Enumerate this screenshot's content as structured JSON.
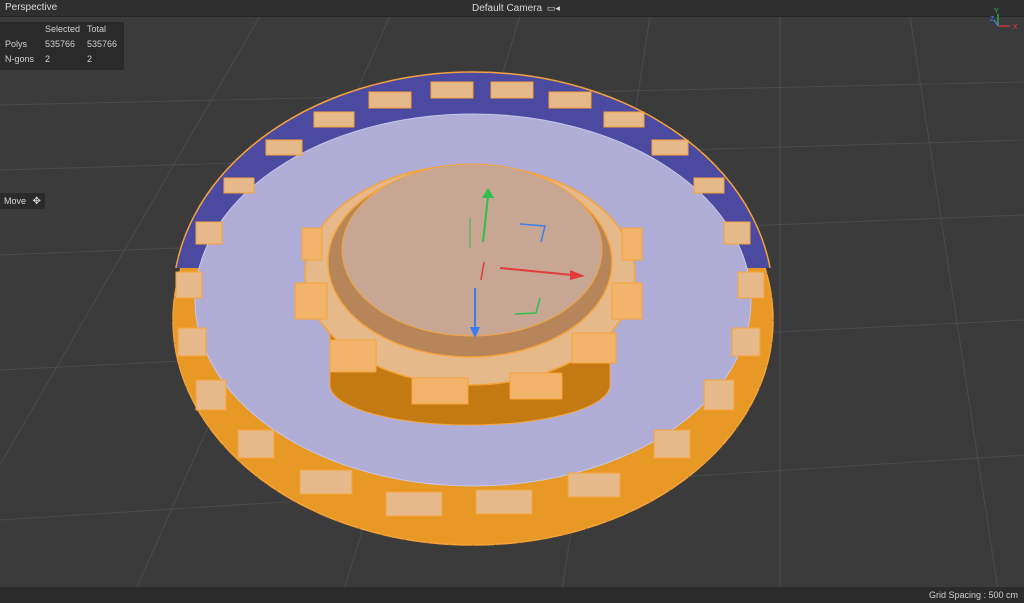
{
  "viewport": {
    "name": "Perspective",
    "camera": "Default Camera",
    "camera_icon": "camera-icon"
  },
  "stats": {
    "header": {
      "selected": "Selected",
      "total": "Total"
    },
    "rows": [
      {
        "label": "Polys",
        "selected": "535766",
        "total": "535766"
      },
      {
        "label": "N-gons",
        "selected": "2",
        "total": "2"
      }
    ]
  },
  "tool": {
    "label": "Move",
    "icon": "move-icon"
  },
  "axes": {
    "x": "X",
    "y": "Y",
    "z": "Z"
  },
  "footer": {
    "grid_spacing": "Grid Spacing : 500 cm"
  },
  "colors": {
    "background": "#3b3b3b",
    "selection_orange": "#f7a33a",
    "wall_blue": "#4b4aa0",
    "floor_lavender": "#b0aed6",
    "arena_top": "#c7a793",
    "axis_x": "#e33b3b",
    "axis_y": "#2fbf4a",
    "axis_z": "#3a7ef0"
  }
}
